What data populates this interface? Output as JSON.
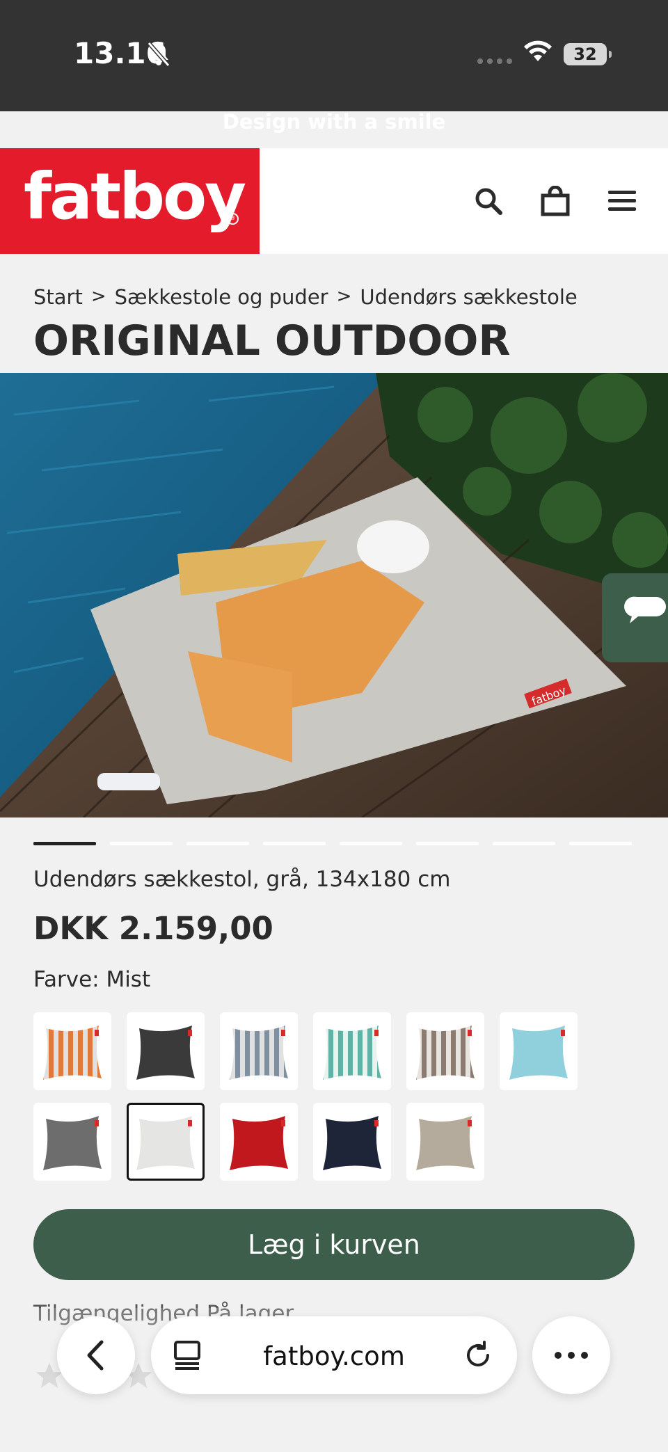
{
  "status": {
    "time": "13.16",
    "battery": "32"
  },
  "banner": {
    "tagline": "Design with a smile"
  },
  "header": {
    "logo": "fatboy",
    "logo_mark": "®"
  },
  "breadcrumb": {
    "items": [
      "Start",
      "Sækkestole og puder",
      "Udendørs sækkestole"
    ],
    "separator": ">"
  },
  "product": {
    "title": "ORIGINAL OUTDOOR",
    "subtitle": "Udendørs sækkestol, grå, 134x180 cm",
    "price": "DKK 2.159,00",
    "color_label": "Farve: Mist",
    "hero_label": "fatboy",
    "gallery_count": 8,
    "gallery_active": 1,
    "swatches": [
      {
        "color": "#e0e0e0",
        "accent": "#e07a3a",
        "pattern": "stripes"
      },
      {
        "color": "#3a3a3a",
        "accent": "#3a3a3a",
        "pattern": "solid"
      },
      {
        "color": "#e0e0e0",
        "accent": "#7e8fa0",
        "pattern": "stripes"
      },
      {
        "color": "#e8f2ef",
        "accent": "#5fb3a6",
        "pattern": "stripes"
      },
      {
        "color": "#e7e3df",
        "accent": "#8c7b70",
        "pattern": "stripes"
      },
      {
        "color": "#8fd0dc",
        "accent": "#8fd0dc",
        "pattern": "solid"
      },
      {
        "color": "#6d6d6d",
        "accent": "#6d6d6d",
        "pattern": "solid"
      },
      {
        "color": "#e5e5e3",
        "accent": "#e5e5e3",
        "pattern": "solid"
      },
      {
        "color": "#c0181d",
        "accent": "#c0181d",
        "pattern": "solid"
      },
      {
        "color": "#1f2538",
        "accent": "#1f2538",
        "pattern": "solid"
      },
      {
        "color": "#b5ab9c",
        "accent": "#b5ab9c",
        "pattern": "solid"
      }
    ],
    "selected_swatch": 7,
    "cart_button": "Læg i kurven",
    "availability": "Tilgængelighed  På lager"
  },
  "browser": {
    "url": "fatboy.com"
  },
  "colors": {
    "brand_red": "#e41b2a",
    "brand_green": "#3e5e4c",
    "status_bg": "#333333"
  }
}
